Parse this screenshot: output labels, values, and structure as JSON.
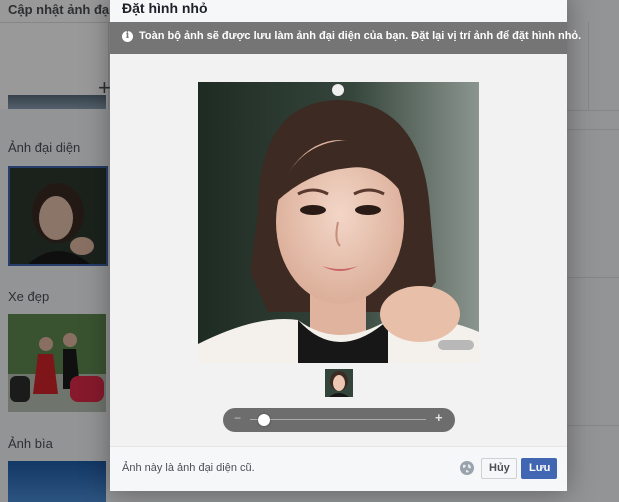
{
  "background": {
    "title": "Cập nhật ảnh đại",
    "sections": [
      {
        "label": "Ảnh đại diện"
      },
      {
        "label": "Xe đẹp"
      },
      {
        "label": "Ảnh bìa"
      }
    ]
  },
  "dialog": {
    "title": "Đặt hình nhỏ",
    "notice": "Toàn bộ ảnh sẽ được lưu làm ảnh đại diện của bạn. Đặt lại vị trí ảnh để đặt hình nhỏ.",
    "zoom": {
      "minus": "−",
      "plus": "+",
      "level": 0.08
    },
    "footer": {
      "text": "Ảnh này là ảnh đại diện cũ.",
      "cancel_label": "Hủy",
      "save_label": "Lưu"
    }
  },
  "icons": [
    "info-icon",
    "plus-icon",
    "globe-icon"
  ],
  "colors": {
    "accent": "#4267b2",
    "notice_bg": "#757575",
    "overlay": "rgba(0,0,0,0.40)"
  }
}
